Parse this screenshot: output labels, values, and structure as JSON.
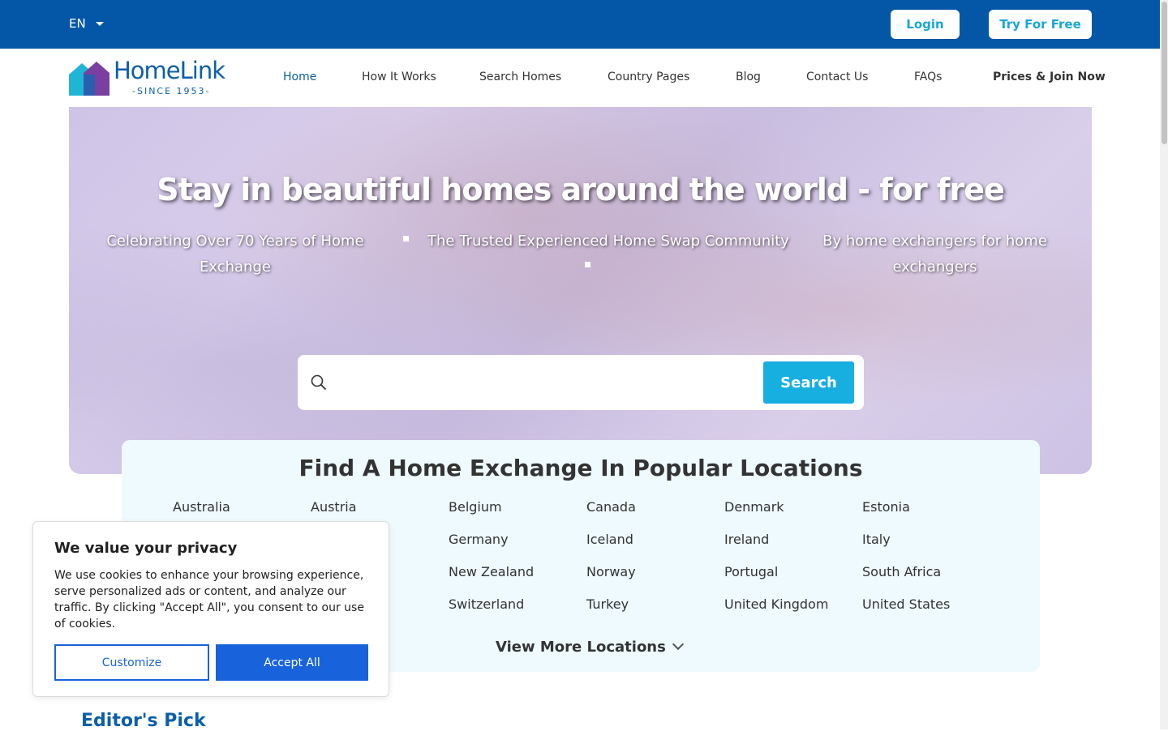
{
  "topbar": {
    "language": "EN",
    "login_label": "Login",
    "try_label": "Try For Free"
  },
  "logo": {
    "name": "HomeLink",
    "since": "-SINCE 1953-"
  },
  "nav": {
    "items": [
      "Home",
      "How It Works",
      "Search Homes",
      "Country Pages",
      "Blog",
      "Contact Us",
      "FAQs",
      "Prices & Join Now"
    ]
  },
  "hero": {
    "title": "Stay in beautiful homes around the world - for free",
    "taglines": [
      "Celebrating Over 70 Years of Home Exchange",
      "The Trusted Experienced Home Swap Community",
      "By home exchangers for home exchangers"
    ]
  },
  "search": {
    "placeholder": "",
    "button_label": "Search"
  },
  "locations": {
    "title_prefix": "Find A Home Exchange In ",
    "title_bold": "Popular Locations",
    "countries": [
      "Australia",
      "Austria",
      "Belgium",
      "Canada",
      "Denmark",
      "Estonia",
      "Germany",
      "Iceland",
      "Ireland",
      "Italy",
      "New Zealand",
      "Norway",
      "Portugal",
      "South Africa",
      "Switzerland",
      "Turkey",
      "United Kingdom",
      "United States"
    ],
    "view_more_label": "View More Locations"
  },
  "editors_pick": "Editor's Pick",
  "cookie": {
    "title": "We value your privacy",
    "text": "We use cookies to enhance your browsing experience, serve personalized ads or content, and analyze our traffic. By clicking \"Accept All\", you consent to our use of cookies.",
    "customize_label": "Customize",
    "accept_label": "Accept All"
  },
  "colors": {
    "topbar": "#0357a6",
    "brand_blue": "#0b5fa8",
    "accent_cyan": "#17afe0",
    "cookie_blue": "#1863dc"
  }
}
